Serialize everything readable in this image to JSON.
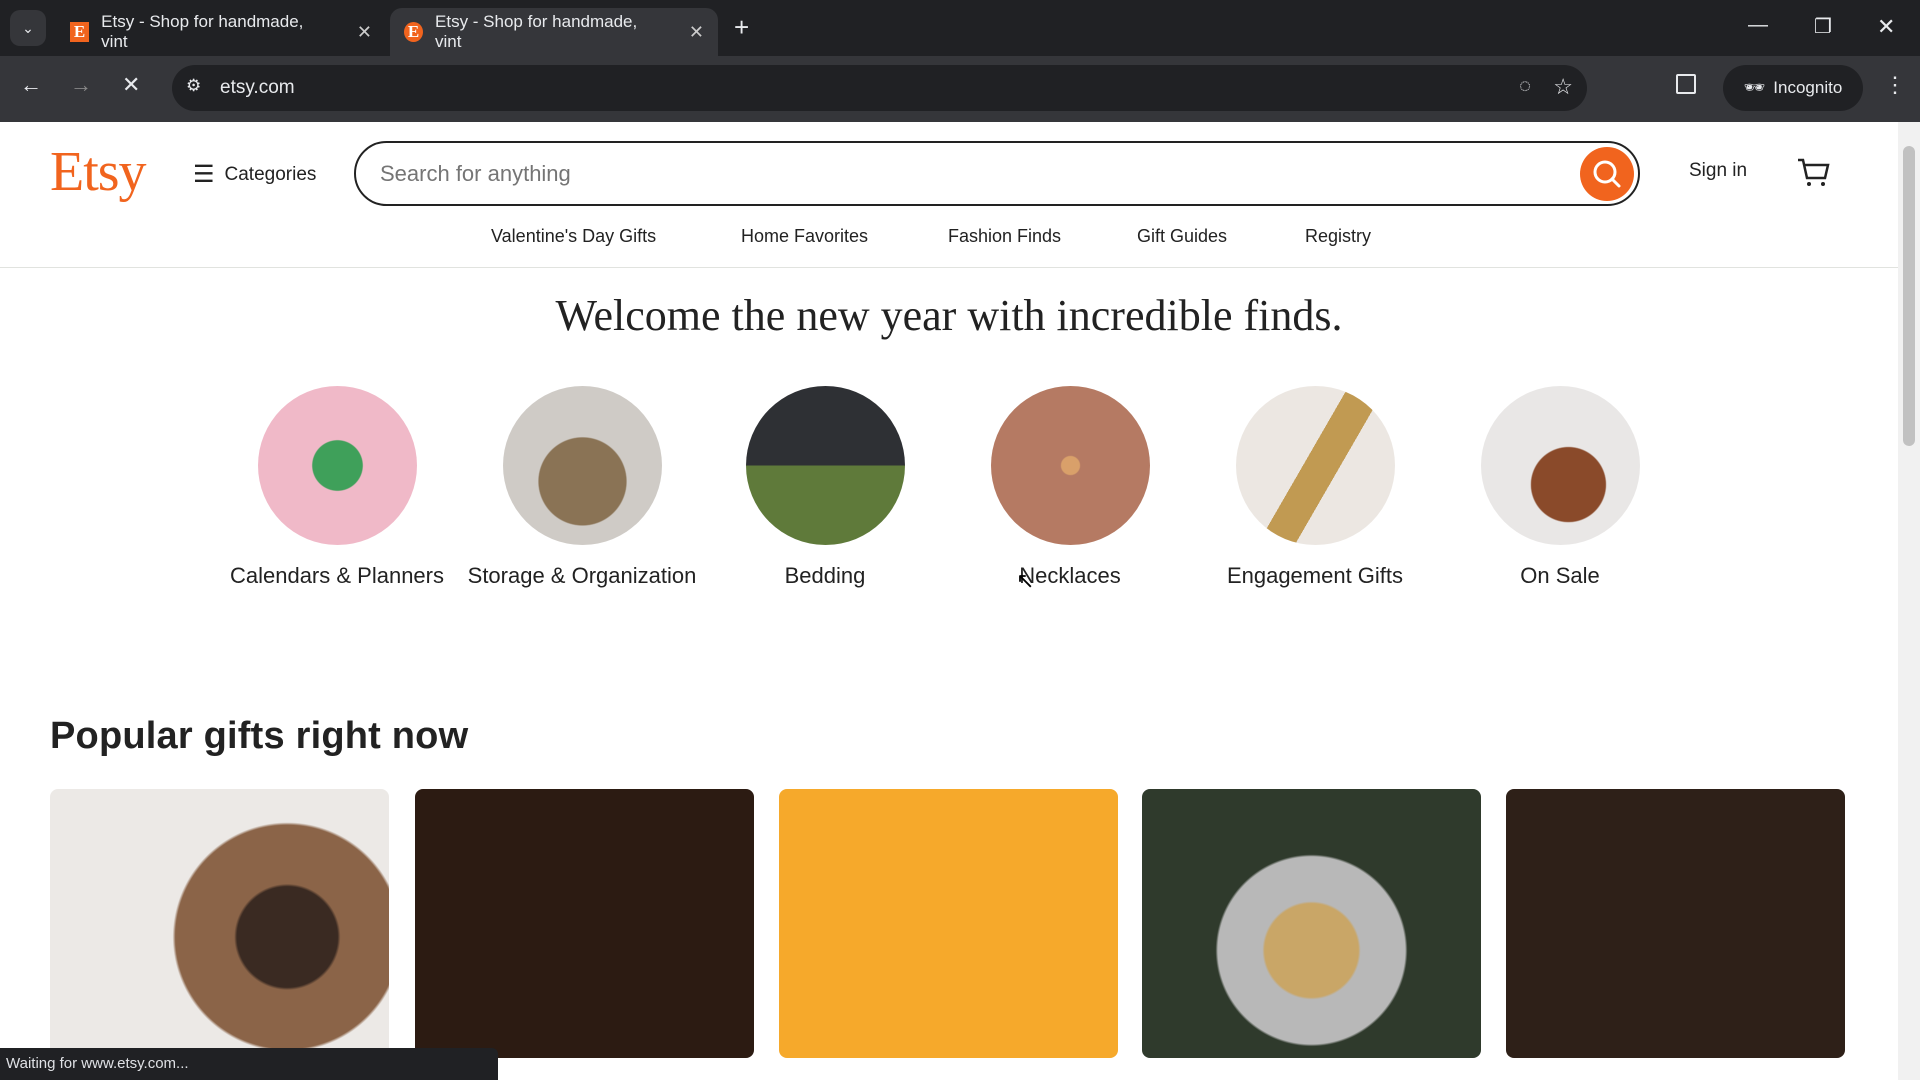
{
  "browser": {
    "tabs": [
      {
        "title": "Etsy - Shop for handmade, vint"
      },
      {
        "title": "Etsy - Shop for handmade, vint"
      }
    ],
    "url": "etsy.com",
    "incognito_label": "Incognito",
    "status_text": "Waiting for www.etsy.com..."
  },
  "header": {
    "logo": "Etsy",
    "categories_label": "Categories",
    "search_placeholder": "Search for anything",
    "sign_in": "Sign in",
    "nav": [
      "Valentine's Day Gifts",
      "Home Favorites",
      "Fashion Finds",
      "Gift Guides",
      "Registry"
    ]
  },
  "hero": {
    "title": "Welcome the new year with incredible finds."
  },
  "categories": [
    {
      "label": "Calendars & Planners"
    },
    {
      "label": "Storage & Organization"
    },
    {
      "label": "Bedding"
    },
    {
      "label": "Necklaces"
    },
    {
      "label": "Engagement Gifts"
    },
    {
      "label": "On Sale"
    }
  ],
  "popular": {
    "title": "Popular gifts right now"
  },
  "colors": {
    "accent": "#f1641e",
    "card_dark": "#2c1b12",
    "card_yellow": "#f6a92b"
  }
}
